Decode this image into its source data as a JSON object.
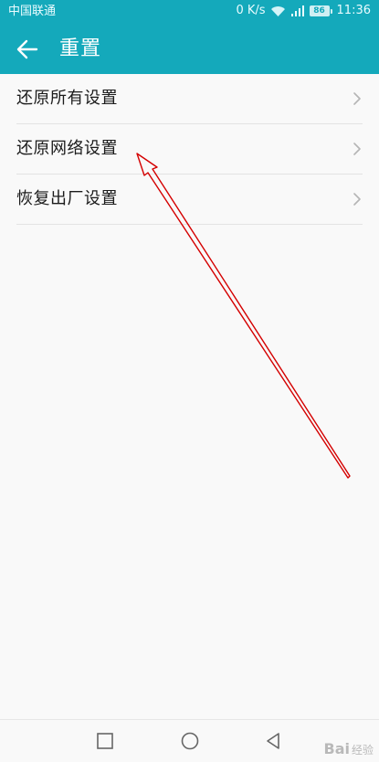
{
  "status_bar": {
    "carrier": "中国联通",
    "net_speed": "0 K/s",
    "battery": "86",
    "time": "11:36"
  },
  "app_bar": {
    "title": "重置"
  },
  "settings": {
    "items": [
      {
        "label": "还原所有设置",
        "icon": "chevron-right-icon"
      },
      {
        "label": "还原网络设置",
        "icon": "chevron-right-icon"
      },
      {
        "label": "恢复出厂设置",
        "icon": "chevron-right-icon"
      }
    ]
  },
  "colors": {
    "accent": "#14a9bb",
    "annotation_arrow": "#d40000"
  },
  "watermark": {
    "brand": "Bai",
    "suffix": "经验"
  }
}
